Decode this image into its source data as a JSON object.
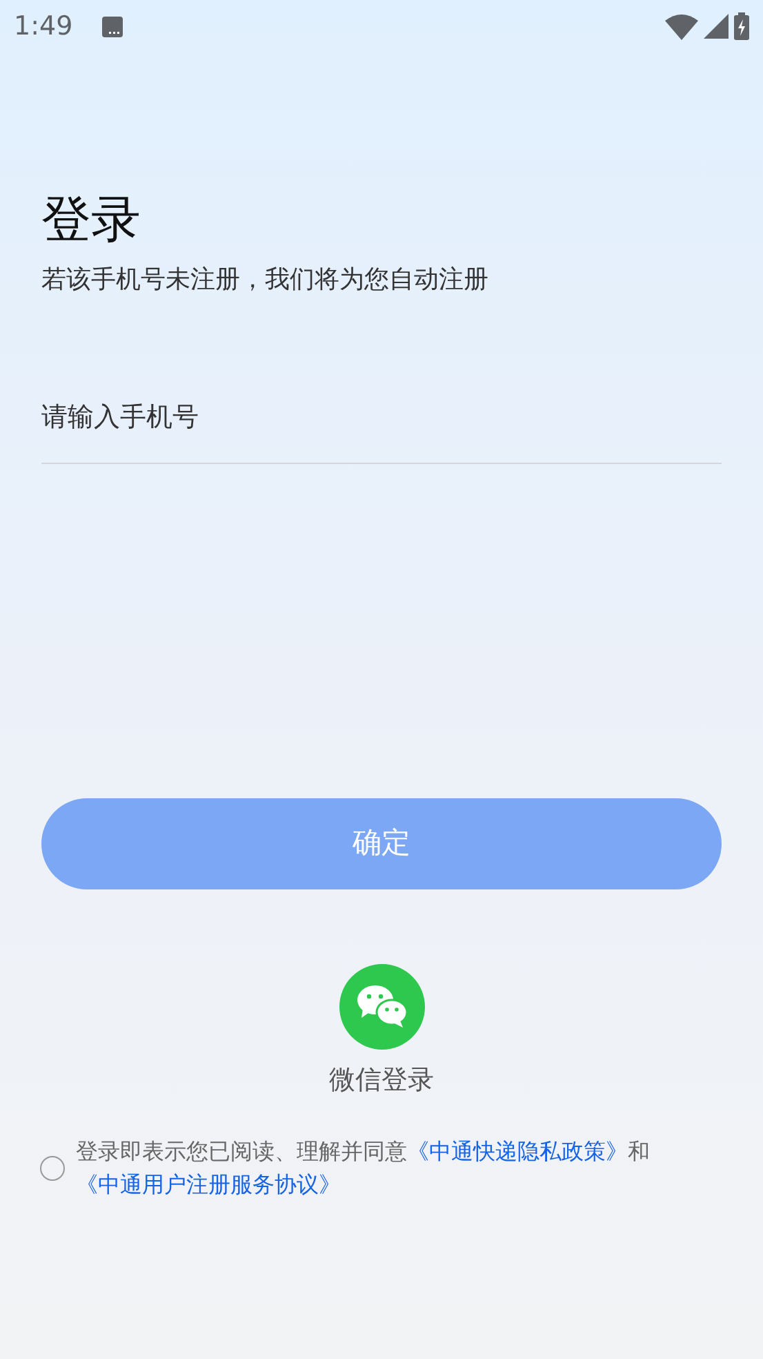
{
  "status_bar": {
    "time": "1:49"
  },
  "title": "登录",
  "subtitle": "若该手机号未注册，我们将为您自动注册",
  "phone_field": {
    "placeholder": "请输入手机号"
  },
  "confirm_button": {
    "label": "确定",
    "disabled": true
  },
  "wechat_login": {
    "label": "微信登录"
  },
  "agreement": {
    "checked": false,
    "text": "登录即表示您已阅读、理解并同意",
    "joiner": "和",
    "links": [
      "《中通快递隐私政策》",
      "《中通用户注册服务协议》"
    ]
  }
}
